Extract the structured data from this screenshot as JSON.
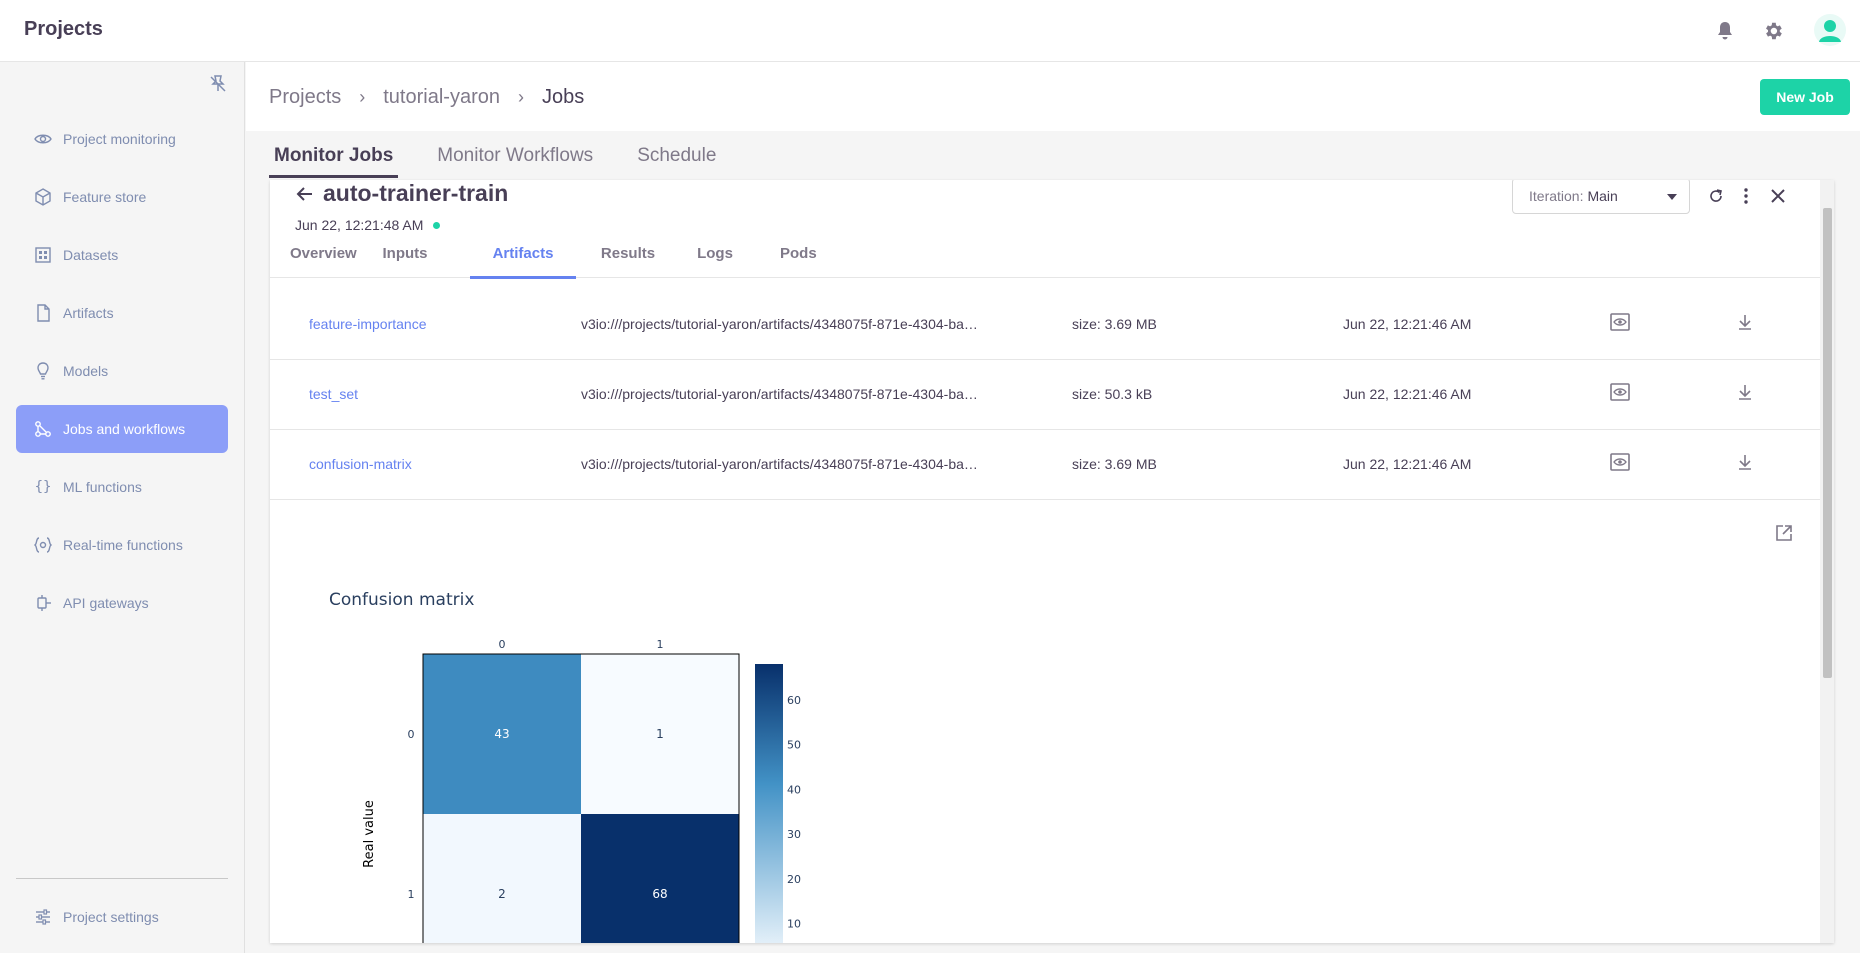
{
  "app": {
    "title": "Projects"
  },
  "header_icons": [
    "bell-icon",
    "gear-icon",
    "user-avatar-icon"
  ],
  "sidebar": {
    "items": [
      {
        "label": "Project monitoring",
        "icon": "eye-icon",
        "active": false
      },
      {
        "label": "Feature store",
        "icon": "cube-icon",
        "active": false
      },
      {
        "label": "Datasets",
        "icon": "grid-icon",
        "active": false
      },
      {
        "label": "Artifacts",
        "icon": "file-icon",
        "active": false
      },
      {
        "label": "Models",
        "icon": "lightbulb-icon",
        "active": false
      },
      {
        "label": "Jobs and workflows",
        "icon": "workflow-icon",
        "active": true
      },
      {
        "label": "ML functions",
        "icon": "braces-icon",
        "active": false
      },
      {
        "label": "Real-time functions",
        "icon": "realtime-icon",
        "active": false
      },
      {
        "label": "API gateways",
        "icon": "gateway-icon",
        "active": false
      }
    ],
    "settings_label": "Project settings"
  },
  "breadcrumb": {
    "items": [
      "Projects",
      "tutorial-yaron",
      "Jobs"
    ]
  },
  "new_job_label": "New Job",
  "tabs": [
    {
      "label": "Monitor Jobs",
      "active": true
    },
    {
      "label": "Monitor Workflows",
      "active": false
    },
    {
      "label": "Schedule",
      "active": false
    }
  ],
  "job": {
    "title": "auto-trainer-train",
    "date": "Jun 22, 12:21:48 AM",
    "status_color": "#1dd3a7",
    "iteration_label": "Iteration:",
    "iteration_value": "Main"
  },
  "detail_tabs": [
    {
      "label": "Overview",
      "active": false
    },
    {
      "label": "Inputs",
      "active": false
    },
    {
      "label": "Artifacts",
      "active": true
    },
    {
      "label": "Results",
      "active": false
    },
    {
      "label": "Logs",
      "active": false
    },
    {
      "label": "Pods",
      "active": false
    }
  ],
  "artifacts": [
    {
      "name": "feature-importance",
      "path": "v3io:///projects/tutorial-yaron/artifacts/4348075f-871e-4304-ba…",
      "size": "size: 3.69 MB",
      "date": "Jun 22, 12:21:46 AM"
    },
    {
      "name": "test_set",
      "path": "v3io:///projects/tutorial-yaron/artifacts/4348075f-871e-4304-ba…",
      "size": "size: 50.3 kB",
      "date": "Jun 22, 12:21:46 AM"
    },
    {
      "name": "confusion-matrix",
      "path": "v3io:///projects/tutorial-yaron/artifacts/4348075f-871e-4304-ba…",
      "size": "size: 3.69 MB",
      "date": "Jun 22, 12:21:46 AM"
    }
  ],
  "colors": {
    "accent": "#6582f0",
    "brand": "#1dd3a7",
    "nav_active": "#8c9ef8"
  },
  "chart_data": {
    "type": "heatmap",
    "title": "Confusion matrix",
    "x_categories": [
      "0",
      "1"
    ],
    "y_categories": [
      "0",
      "1"
    ],
    "ylabel": "Real value",
    "values": [
      [
        43,
        1
      ],
      [
        2,
        68
      ]
    ],
    "colorscale": "Blues",
    "colorbar_ticks": [
      10,
      20,
      30,
      40,
      50,
      60
    ]
  }
}
